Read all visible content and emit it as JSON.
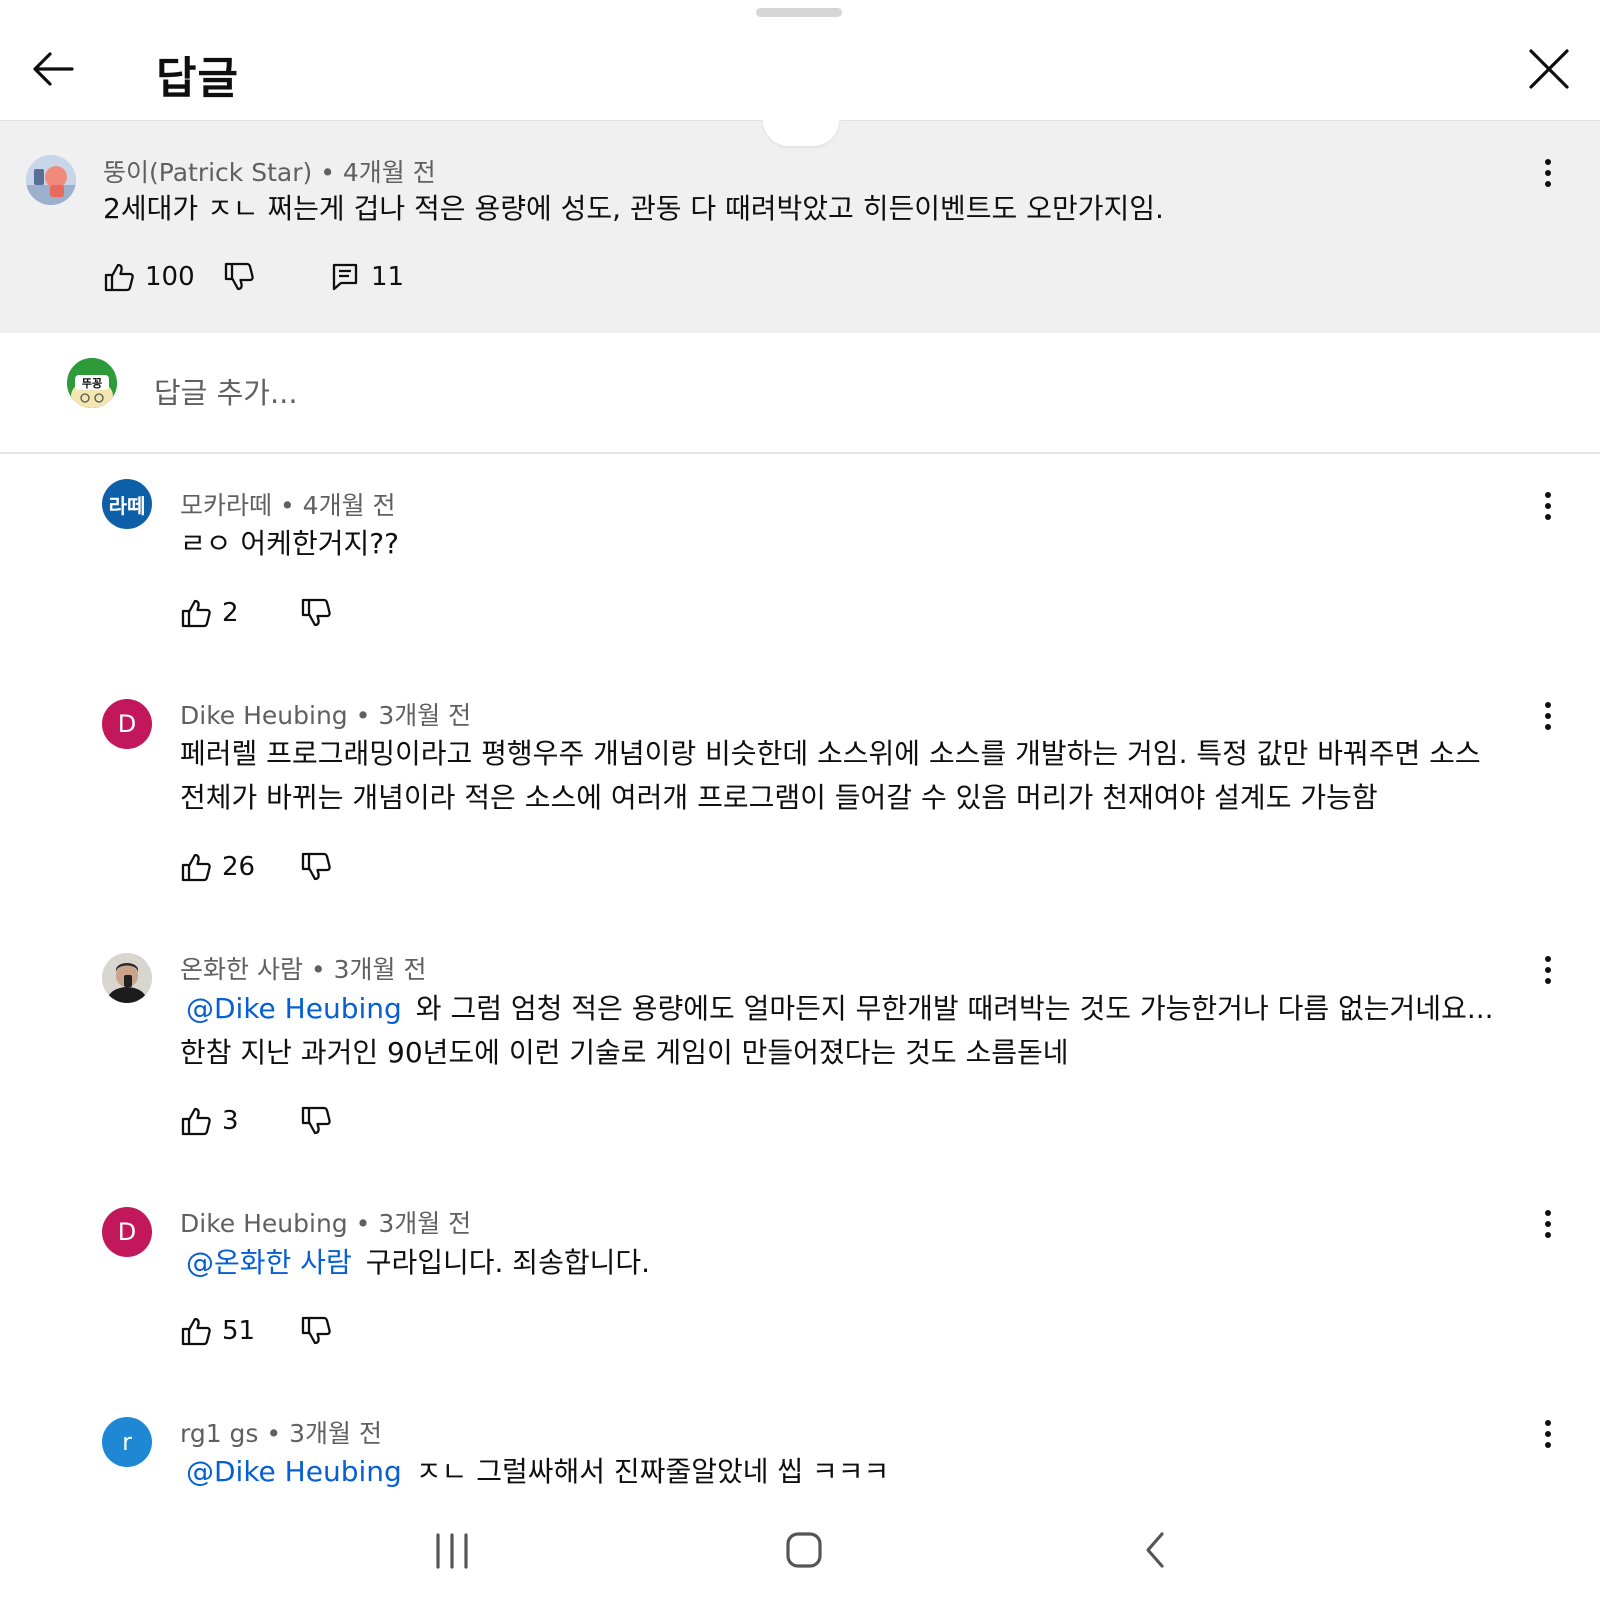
{
  "header": {
    "title": "답글"
  },
  "parent_comment": {
    "author": "뚱이(Patrick Star)",
    "time": "4개월 전",
    "text": "2세대가 ㅈㄴ 쩌는게 겁나 적은 용량에 성도, 관동 다 때려박았고 히든이벤트도 오만가지임.",
    "likes": "100",
    "replies": "11"
  },
  "reply_input": {
    "avatar_text": "뚜꽁",
    "placeholder": "답글 추가..."
  },
  "replies": [
    {
      "author": "모카라떼",
      "time": "4개월 전",
      "avatar_text": "라떼",
      "avatar_color": "#0d5fa8",
      "mention": "",
      "text": "ㄹㅇ 어케한거지??",
      "likes": "2"
    },
    {
      "author": "Dike Heubing",
      "time": "3개월 전",
      "avatar_text": "D",
      "avatar_color": "#c2185b",
      "mention": "",
      "text_line1": "페러렐 프로그래밍이라고 평행우주 개념이랑 비슷한데 소스위에 소스를 개발하는 거임. 특정 값만 바꿔주면 소스",
      "text_line2": "전체가 바뀌는 개념이라 적은 소스에 여러개 프로그램이 들어갈 수 있음 머리가 천재여야 설계도 가능함",
      "likes": "26"
    },
    {
      "author": "온화한 사람",
      "time": "3개월 전",
      "avatar_text": "",
      "avatar_color": "#d9d5cf",
      "mention": "@Dike Heubing",
      "text_line1": "와 그럼 엄청 적은 용량에도 얼마든지 무한개발 때려박는 것도 가능한거나 다름 없는거네요...",
      "text_line2": "한참 지난 과거인 90년도에 이런 기술로 게임이 만들어졌다는 것도 소름돋네",
      "likes": "3"
    },
    {
      "author": "Dike Heubing",
      "time": "3개월 전",
      "avatar_text": "D",
      "avatar_color": "#c2185b",
      "mention": "@온화한 사람",
      "text": "구라입니다. 죄송합니다.",
      "likes": "51"
    },
    {
      "author": "rg1 gs",
      "time": "3개월 전",
      "avatar_text": "r",
      "avatar_color": "#1e88d4",
      "mention": "@Dike Heubing",
      "text": "ㅈㄴ 그럴싸해서 진짜줄알았네 씹 ㅋㅋㅋ"
    }
  ]
}
